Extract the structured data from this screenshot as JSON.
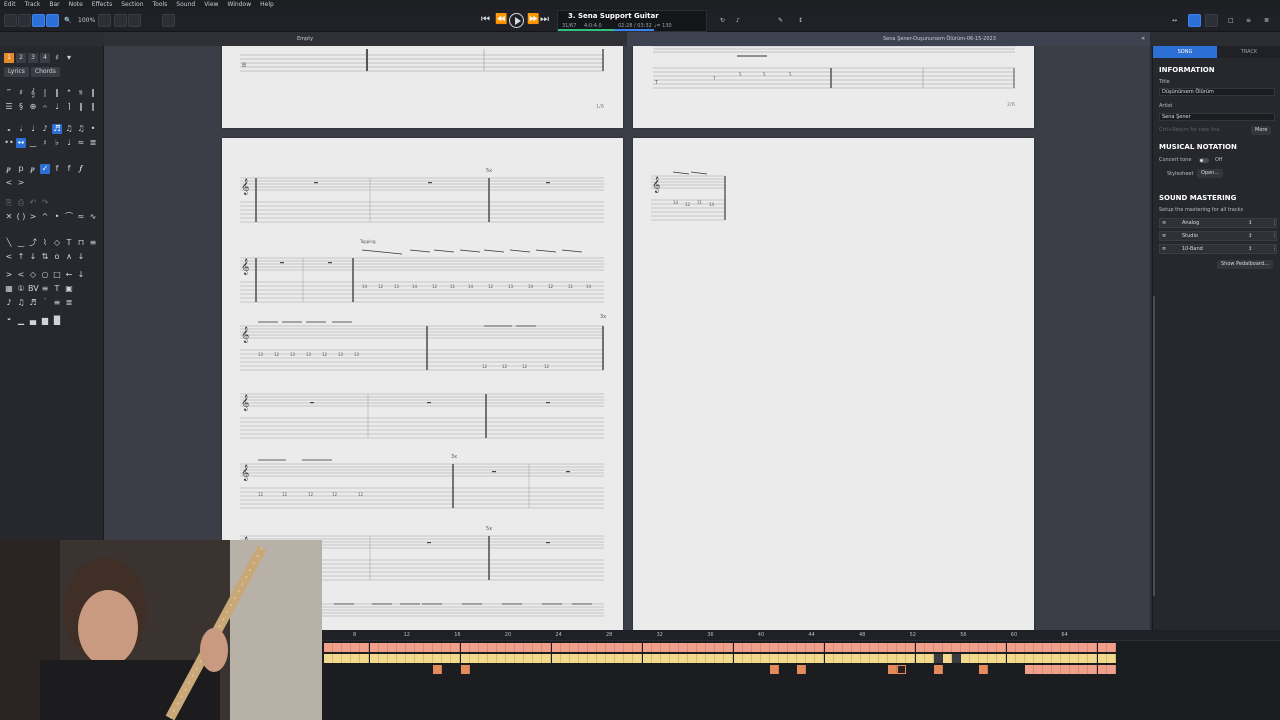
{
  "menu": [
    "Edit",
    "Track",
    "Bar",
    "Note",
    "Effects",
    "Section",
    "Tools",
    "Sound",
    "View",
    "Window",
    "Help"
  ],
  "toolbar": {
    "zoom": "100%",
    "track_title": "3. Sena Support Guitar",
    "bar_position": "31/67",
    "signature": "4:0:4.0",
    "time": "02:28 / 03:32",
    "tempo": "♩= 130"
  },
  "tabs": {
    "left": "Empty",
    "right": "Sena Şener-Duşunursem Ölürüm-06-15-2023"
  },
  "palette": {
    "layers": [
      "1",
      "2",
      "3",
      "4"
    ],
    "lyrics": "Lyrics",
    "chords": "Chords"
  },
  "score": {
    "page1_num": "1/6",
    "page2_num": "2/6",
    "repeat_3x_a": "3x",
    "repeat_5x_a": "5x",
    "repeat_3x_b": "3x",
    "repeat_5x_b": "5x",
    "tapping": "Tapping"
  },
  "inspector": {
    "tab_song": "SONG",
    "tab_track": "TRACK",
    "info_heading": "INFORMATION",
    "title_label": "Title",
    "title_value": "Düşünürsem Ölürüm",
    "artist_label": "Artist",
    "artist_value": "Sena Şener",
    "hint": "Ctrl+Return for new line",
    "more": "More",
    "notation_heading": "MUSICAL NOTATION",
    "concert_tone": "Concert tone",
    "concert_tone_state": "Off",
    "stylesheet_label": "Stylesheet",
    "stylesheet_btn": "Open...",
    "mastering_heading": "SOUND MASTERING",
    "mastering_desc": "Setup the mastering for all tracks",
    "mastering_items": [
      "Analog",
      "Studio",
      "10-Band"
    ],
    "pedalboard_btn": "Show Pedalboard..."
  },
  "timeline": {
    "ruler": [
      "8",
      "12",
      "16",
      "20",
      "24",
      "28",
      "32",
      "36",
      "40",
      "44",
      "48",
      "52",
      "56",
      "60",
      "64"
    ]
  },
  "colors": {
    "accent": "#2c6fd6",
    "block_salmon": "#f0a08a",
    "block_yellow": "#f2d88a",
    "block_orange": "#e58a5a"
  }
}
